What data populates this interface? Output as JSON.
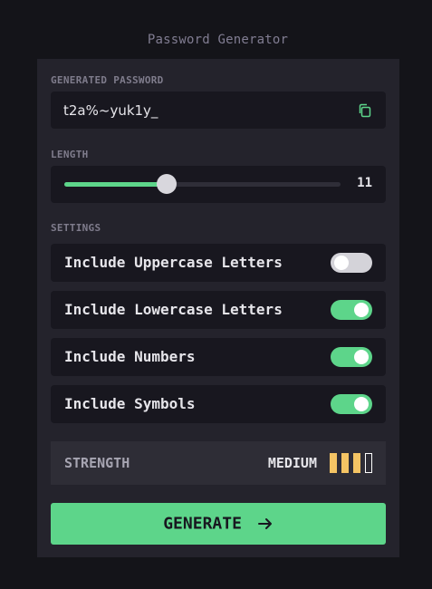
{
  "app": {
    "title": "Password Generator"
  },
  "password": {
    "section_label": "GENERATED PASSWORD",
    "value": "t2a%~yuk1y_",
    "copy_icon": "copy-icon"
  },
  "length": {
    "section_label": "LENGTH",
    "value": "11",
    "slider_fraction": 0.37
  },
  "settings": {
    "section_label": "SETTINGS",
    "items": [
      {
        "label": "Include Uppercase Letters",
        "enabled": false
      },
      {
        "label": "Include Lowercase Letters",
        "enabled": true
      },
      {
        "label": "Include Numbers",
        "enabled": true
      },
      {
        "label": "Include Symbols",
        "enabled": true
      }
    ]
  },
  "strength": {
    "label": "STRENGTH",
    "value": "MEDIUM",
    "level": 3,
    "max_level": 4
  },
  "generate": {
    "label": "GENERATE",
    "arrow_icon": "arrow-right-icon"
  },
  "colors": {
    "accent": "#5dd58a",
    "strength_medium": "#f4c464",
    "background": "#141419",
    "card": "#24232c"
  }
}
